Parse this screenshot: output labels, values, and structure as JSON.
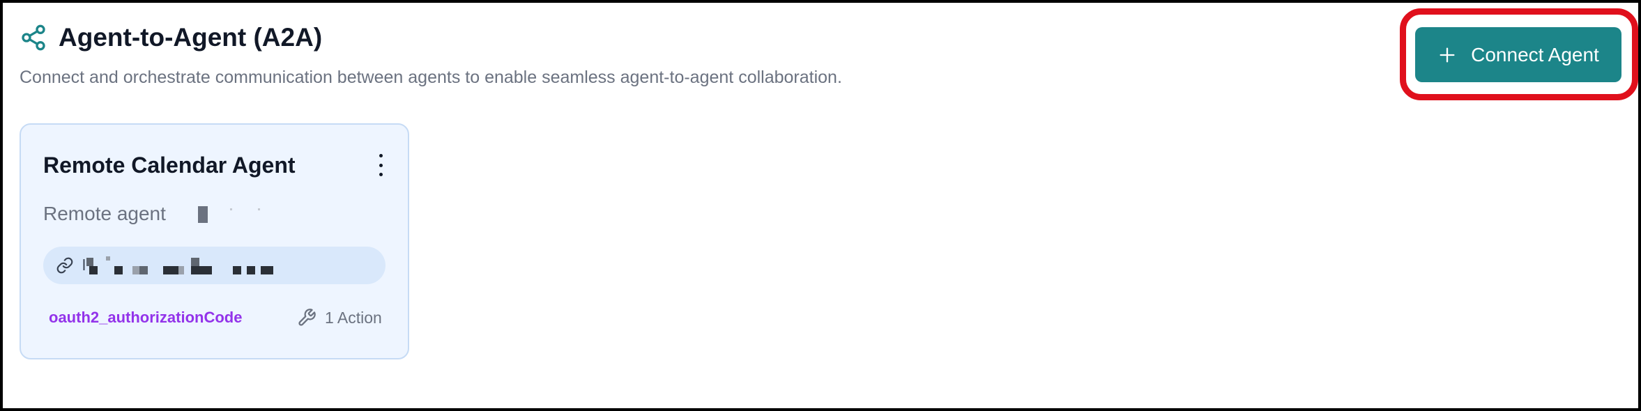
{
  "header": {
    "icon": "share-icon",
    "title": "Agent-to-Agent (A2A)",
    "subtitle": "Connect and orchestrate communication between agents to enable seamless agent-to-agent collaboration."
  },
  "toolbar": {
    "connect_label": "Connect Agent",
    "connect_icon": "plus-icon"
  },
  "agents": [
    {
      "name": "Remote Calendar Agent",
      "description": "Remote agent",
      "url_prefix": "l",
      "auth_type": "oauth2_authorizationCode",
      "actions_label": "1 Action",
      "menu_icon": "more-vertical-icon",
      "url_icon": "link-icon",
      "actions_icon": "wrench-icon"
    }
  ],
  "colors": {
    "accent": "#1c8589",
    "highlight": "#e0101c",
    "card_bg": "#eef5ff",
    "auth_badge": "#9333ea"
  }
}
